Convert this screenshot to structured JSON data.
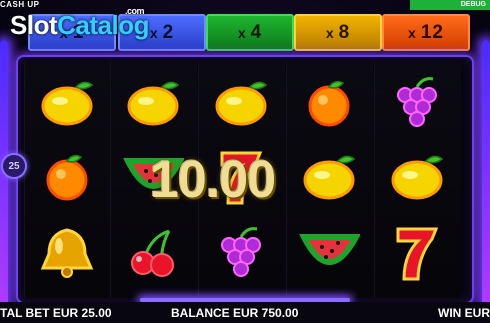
{
  "game": {
    "title": "CASH UP",
    "debug_label": "DEBUG",
    "lines_badge": "25",
    "watermark": {
      "slot": "Slot",
      "catalog": "Catalog",
      "com": ".com"
    }
  },
  "multipliers": [
    {
      "prefix": "x",
      "value": "1",
      "color": "#3f5ef0"
    },
    {
      "prefix": "x",
      "value": "2",
      "color": "#3f5ef0"
    },
    {
      "prefix": "x",
      "value": "4",
      "color": "#1aa82c"
    },
    {
      "prefix": "x",
      "value": "8",
      "color": "#e0a500"
    },
    {
      "prefix": "x",
      "value": "12",
      "color": "#f25c10"
    }
  ],
  "reels": [
    [
      "lemon",
      "orange",
      "bell"
    ],
    [
      "lemon",
      "watermelon",
      "cherries"
    ],
    [
      "lemon",
      "seven",
      "grapes"
    ],
    [
      "orange",
      "lemon",
      "watermelon"
    ],
    [
      "grapes",
      "lemon",
      "seven"
    ]
  ],
  "win_display": "10.00",
  "footer": {
    "total_bet": "TAL BET EUR 25.00",
    "balance": "BALANCE EUR 750.00",
    "win": "WIN EUR"
  }
}
